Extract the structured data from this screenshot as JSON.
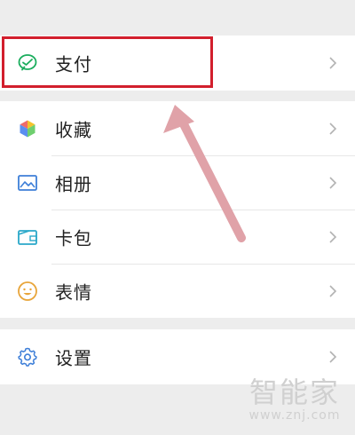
{
  "menu": {
    "pay": {
      "label": "支付",
      "icon": "wechat-pay-icon"
    },
    "favorites": {
      "label": "收藏",
      "icon": "favorites-cube-icon"
    },
    "album": {
      "label": "相册",
      "icon": "album-picture-icon"
    },
    "cards": {
      "label": "卡包",
      "icon": "card-wallet-icon"
    },
    "stickers": {
      "label": "表情",
      "icon": "sticker-smile-icon"
    },
    "settings": {
      "label": "设置",
      "icon": "settings-gear-icon"
    }
  },
  "annotation": {
    "highlight_color": "#d21f2d",
    "arrow_color": "#e0a2a8"
  },
  "watermark": {
    "logo": "智能家",
    "url": "www.znj.com"
  }
}
